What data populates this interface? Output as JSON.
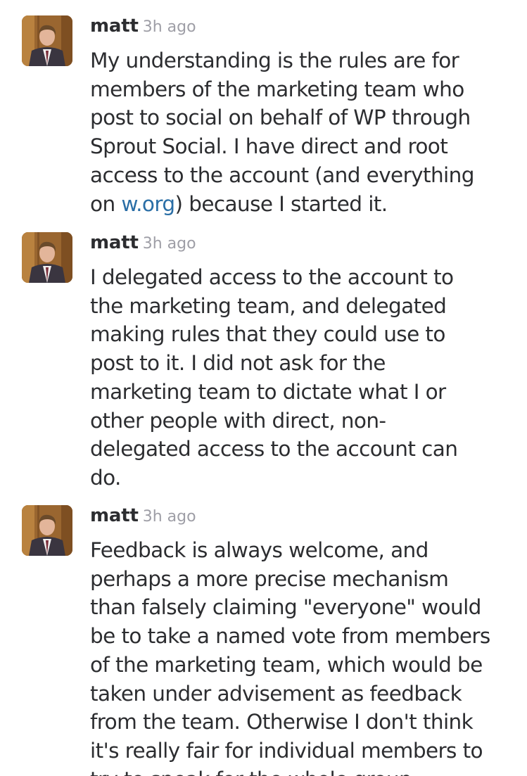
{
  "messages": [
    {
      "author": "matt",
      "time": "3h ago",
      "lines": [
        "My understanding is the rules are for",
        "members of the marketing team who",
        "post to social on behalf of WP through",
        "Sprout Social. I have direct and root",
        "access to the account (and everything"
      ],
      "last_line_prefix": "on ",
      "link_text": "w.org",
      "last_line_suffix": ") because I started it."
    },
    {
      "author": "matt",
      "time": "3h ago",
      "lines": [
        "I delegated access to the account to",
        "the marketing team, and delegated",
        "making rules that they could use to",
        "post to it. I did not ask for the",
        "marketing team to dictate what I or",
        "other people with direct, non-",
        "delegated access to the account can",
        "do."
      ]
    },
    {
      "author": "matt",
      "time": "3h ago",
      "lines": [
        "Feedback is always welcome, and",
        "perhaps a more precise mechanism",
        "than falsely claiming \"everyone\" would",
        "be to take a named vote from members",
        "of the marketing team, which would be",
        "taken under advisement as feedback",
        "from the team. Otherwise I don't think",
        "it's really fair for individual members to",
        "try to speak for the whole group."
      ]
    }
  ]
}
